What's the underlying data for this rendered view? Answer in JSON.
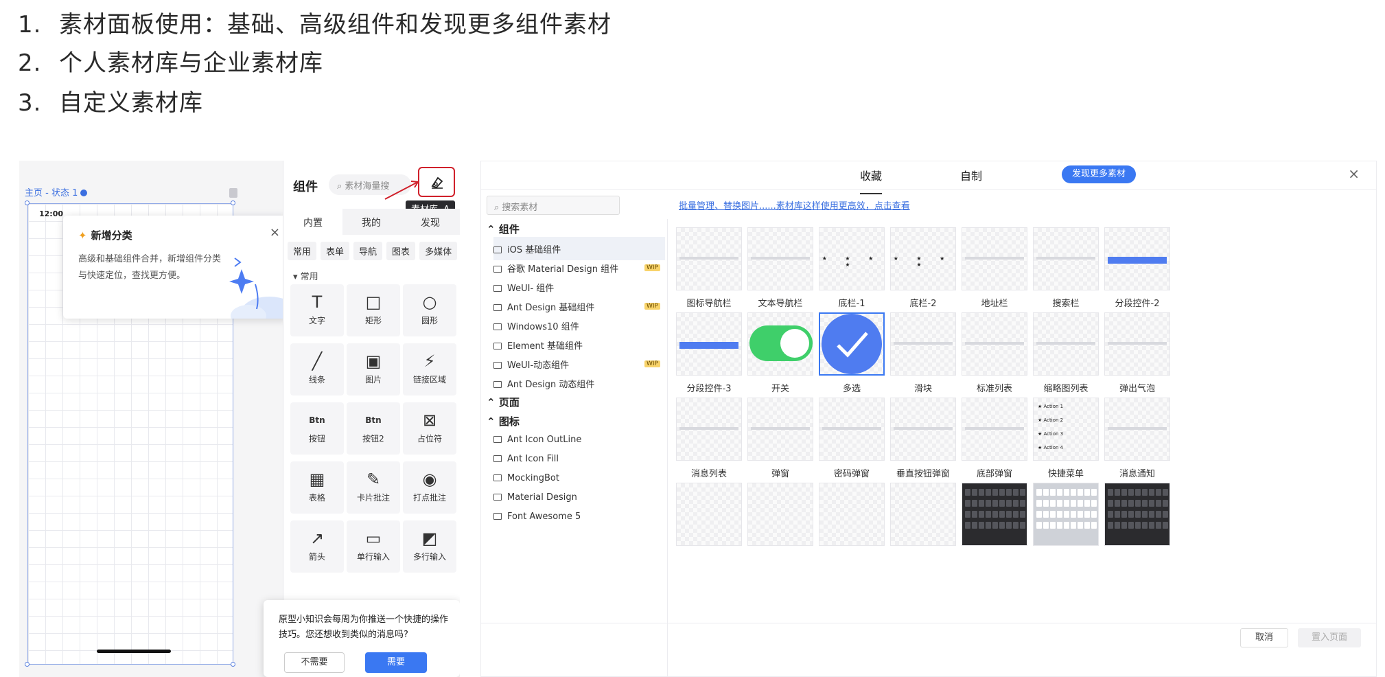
{
  "intro": {
    "items": [
      {
        "num": "1.",
        "text": "素材面板使用：基础、高级组件和发现更多组件素材"
      },
      {
        "num": "2.",
        "text": "个人素材库与企业素材库"
      },
      {
        "num": "3.",
        "text": "自定义素材库"
      }
    ]
  },
  "editor": {
    "canvas_label": "主页 - 状态 1",
    "status_time": "12:00",
    "tip": {
      "title": "新增分类",
      "desc": "高级和基础组件合并，新增组件分类与快速定位，查找更方便。",
      "close": "×"
    },
    "panel": {
      "title": "组件",
      "search_placeholder": "素材海量搜",
      "tooltip": "素材库",
      "tooltip_key": "A",
      "tabs": [
        "内置",
        "我的",
        "发现"
      ],
      "chips": [
        "常用",
        "表单",
        "导航",
        "图表",
        "多媒体"
      ],
      "section": "常用",
      "widgets": [
        {
          "icon": "T",
          "label": "文字"
        },
        {
          "icon": "□",
          "label": "矩形"
        },
        {
          "icon": "○",
          "label": "圆形"
        },
        {
          "icon": "╱",
          "label": "线条"
        },
        {
          "icon": "▣",
          "label": "图片"
        },
        {
          "icon": "⚡",
          "label": "链接区域"
        },
        {
          "icon": "Btn",
          "label": "按钮"
        },
        {
          "icon": "Btn",
          "label": "按钮2"
        },
        {
          "icon": "⊠",
          "label": "占位符"
        },
        {
          "icon": "▦",
          "label": "表格"
        },
        {
          "icon": "✎",
          "label": "卡片批注"
        },
        {
          "icon": "◉",
          "label": "打点批注"
        },
        {
          "icon": "↗",
          "label": "箭头"
        },
        {
          "icon": "▭",
          "label": "单行输入"
        },
        {
          "icon": "◩",
          "label": "多行输入"
        }
      ]
    },
    "notify": {
      "text": "原型小知识会每周为你推送一个快捷的操作技巧。您还想收到类似的消息吗?",
      "no": "不需要",
      "yes": "需要"
    }
  },
  "library": {
    "tabs": [
      "收藏",
      "自制"
    ],
    "discover": "发现更多素材",
    "close": "×",
    "search_placeholder": "搜索素材",
    "banner": "批量管理、替换图片......素材库这样使用更高效，点击查看",
    "groups": [
      {
        "label": "组件",
        "items": [
          {
            "label": "iOS 基础组件",
            "wip": ""
          },
          {
            "label": "谷歌 Material Design 组件",
            "wip": "WIP"
          },
          {
            "label": "WeUI- 组件",
            "wip": ""
          },
          {
            "label": "Ant Design 基础组件",
            "wip": "WIP"
          },
          {
            "label": "Windows10 组件",
            "wip": ""
          },
          {
            "label": "Element 基础组件",
            "wip": ""
          },
          {
            "label": "WeUI-动态组件",
            "wip": "WIP"
          },
          {
            "label": "Ant Design 动态组件",
            "wip": ""
          }
        ]
      },
      {
        "label": "页面",
        "items": []
      },
      {
        "label": "图标",
        "items": [
          {
            "label": "Ant Icon OutLine",
            "wip": ""
          },
          {
            "label": "Ant Icon Fill",
            "wip": ""
          },
          {
            "label": "MockingBot",
            "wip": ""
          },
          {
            "label": "Material Design",
            "wip": ""
          },
          {
            "label": "Font Awesome 5",
            "wip": ""
          }
        ]
      }
    ],
    "cards": [
      {
        "label": "图标导航栏",
        "kind": "nav"
      },
      {
        "label": "文本导航栏",
        "kind": "nav"
      },
      {
        "label": "底栏-1",
        "kind": "stars"
      },
      {
        "label": "底栏-2",
        "kind": "stars"
      },
      {
        "label": "地址栏",
        "kind": "bar"
      },
      {
        "label": "搜索栏",
        "kind": "bar"
      },
      {
        "label": "分段控件-2",
        "kind": "seg"
      },
      {
        "label": "分段控件-3",
        "kind": "seg"
      },
      {
        "label": "开关",
        "kind": "toggle"
      },
      {
        "label": "多选",
        "kind": "check"
      },
      {
        "label": "滑块",
        "kind": "slider"
      },
      {
        "label": "标准列表",
        "kind": "list"
      },
      {
        "label": "缩略图列表",
        "kind": "list"
      },
      {
        "label": "弹出气泡",
        "kind": "popover"
      },
      {
        "label": "消息列表",
        "kind": "list"
      },
      {
        "label": "弹窗",
        "kind": "dialog"
      },
      {
        "label": "密码弹窗",
        "kind": "dialog"
      },
      {
        "label": "垂直按钮弹窗",
        "kind": "dialog"
      },
      {
        "label": "底部弹窗",
        "kind": "dialog"
      },
      {
        "label": "快捷菜单",
        "kind": "menu"
      },
      {
        "label": "消息通知",
        "kind": "list"
      },
      {
        "label": "",
        "kind": "plain"
      },
      {
        "label": "",
        "kind": "plain"
      },
      {
        "label": "",
        "kind": "plain"
      },
      {
        "label": "",
        "kind": "plain"
      },
      {
        "label": "",
        "kind": "keyboard-dark"
      },
      {
        "label": "",
        "kind": "keyboard-light"
      },
      {
        "label": "",
        "kind": "keyboard-dark"
      }
    ],
    "menu_actions": [
      "Action 1",
      "Action 2",
      "Action 3",
      "Action 4"
    ],
    "cancel": "取消",
    "insert": "置入页面"
  },
  "colors": {
    "accent": "#3a78f2",
    "highlight_border": "#d0202a",
    "toggle_green": "#3fcf6a"
  }
}
